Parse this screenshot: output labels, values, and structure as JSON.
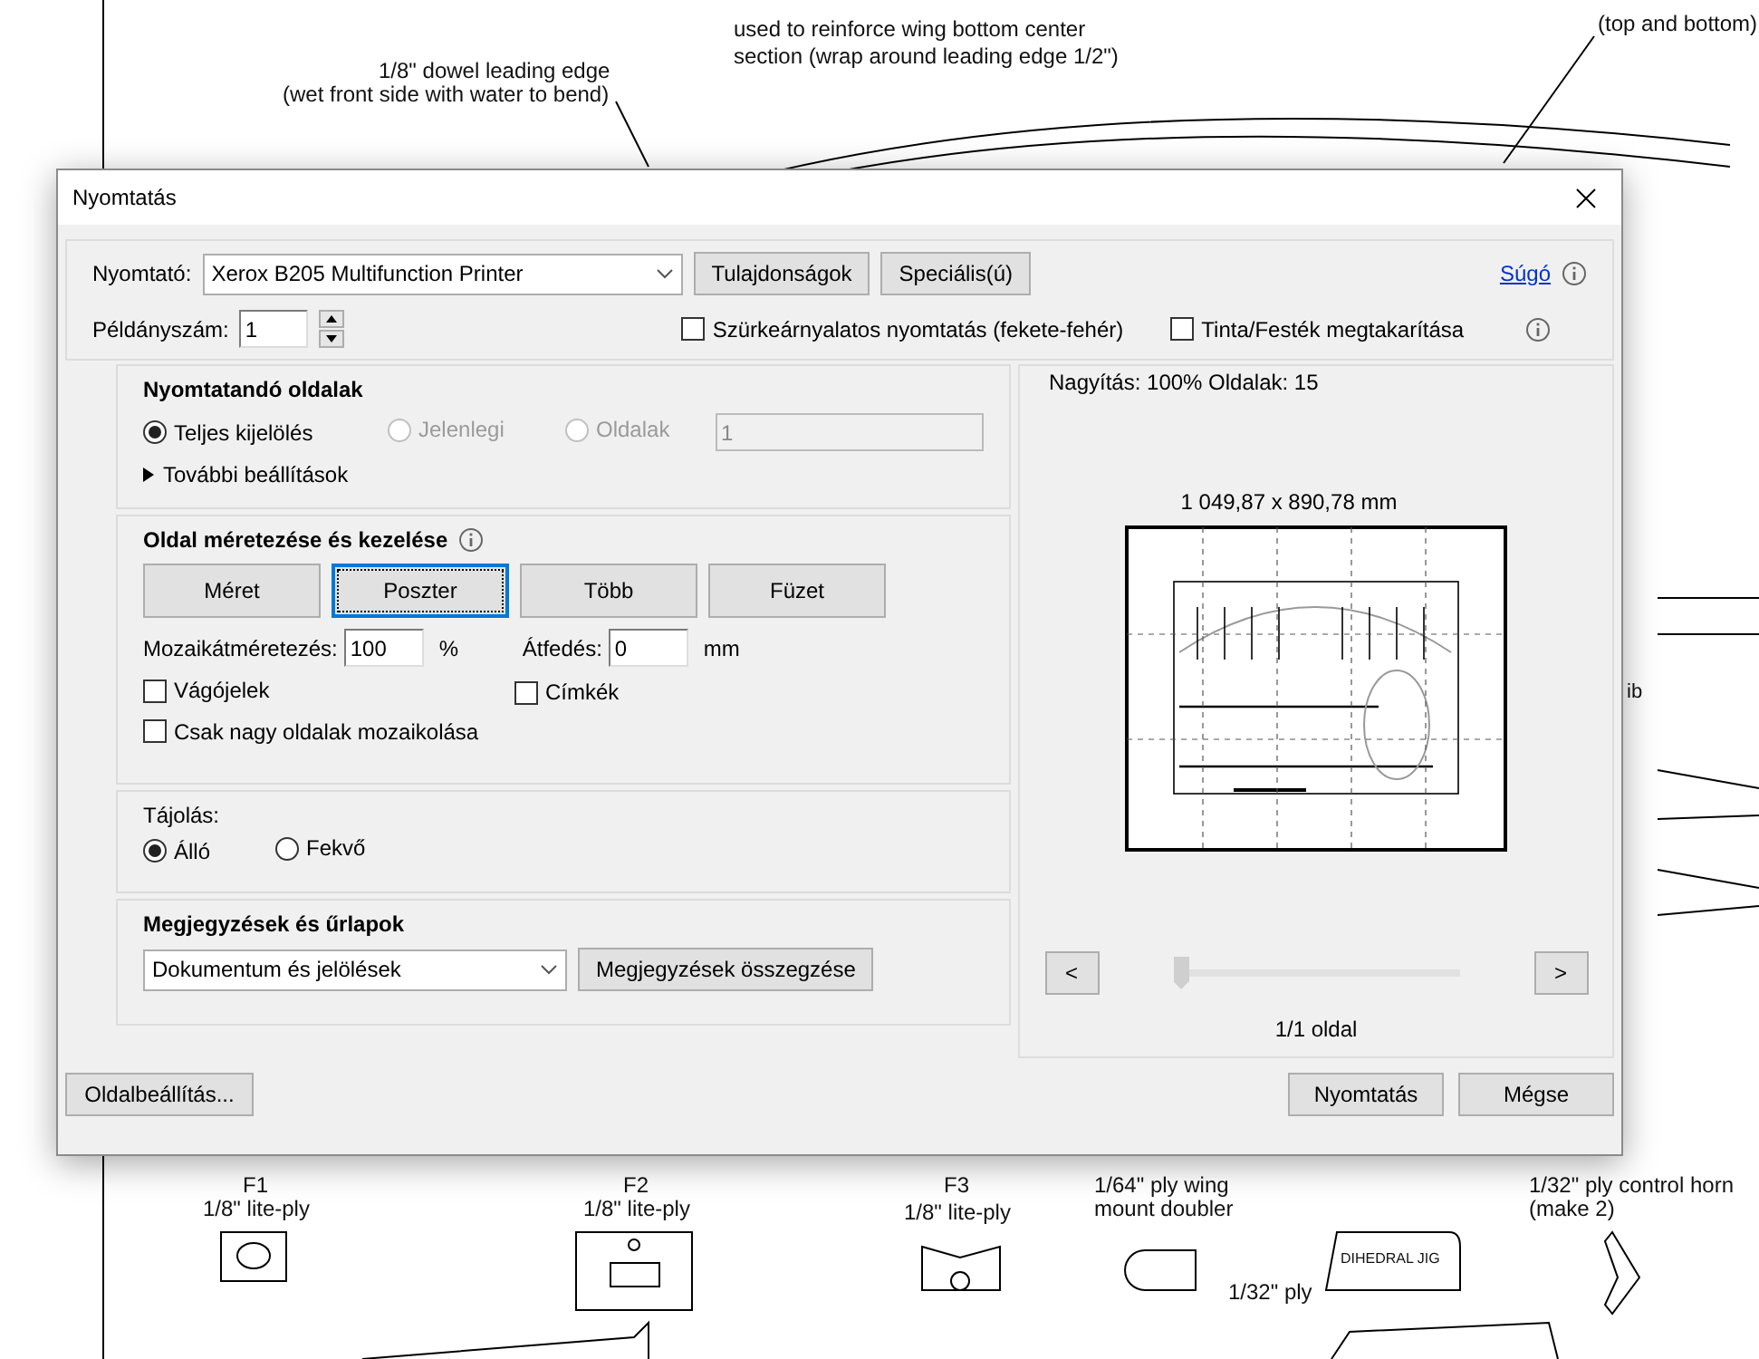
{
  "document": {
    "labels": [
      {
        "text": "used to reinforce wing bottom center"
      },
      {
        "text": "section (wrap around leading edge 1/2\")"
      },
      {
        "text": "1/8\" dowel leading edge"
      },
      {
        "text": "(wet front side with water to bend)"
      },
      {
        "text": "(top and bottom)"
      },
      {
        "text": "ib"
      },
      {
        "text": "F1"
      },
      {
        "text": "1/8\" lite-ply"
      },
      {
        "text": "F2"
      },
      {
        "text": "1/8\" lite-ply"
      },
      {
        "text": "F3"
      },
      {
        "text": "1/8\" lite-ply"
      },
      {
        "text": "1/64\" ply wing"
      },
      {
        "text": "mount doubler"
      },
      {
        "text": "DIHEDRAL JIG"
      },
      {
        "text": "1/32\" ply control horn"
      },
      {
        "text": "(make 2)"
      },
      {
        "text": "1/32\" ply"
      }
    ]
  },
  "dialog": {
    "title": "Nyomtatás",
    "printer": {
      "label": "Nyomtató:",
      "value": "Xerox B205 Multifunction Printer",
      "buttons": [
        "Tulajdonságok",
        "Speciális(ú)"
      ],
      "help": "Súgó"
    },
    "copies": {
      "label": "Példányszám:",
      "value": "1"
    },
    "options": [
      {
        "label": "Szürkeárnyalatos nyomtatás (fekete-fehér)",
        "checked": false
      },
      {
        "label": "Tinta/Festék megtakarítása",
        "checked": false
      }
    ],
    "pages": {
      "title": "Nyomtatandó oldalak",
      "radios": [
        {
          "label": "Teljes kijelölés",
          "selected": true,
          "disabled": false
        },
        {
          "label": "Jelenlegi",
          "selected": false,
          "disabled": true
        },
        {
          "label": "Oldalak",
          "selected": false,
          "disabled": true
        }
      ],
      "range": "1",
      "more": "További beállítások"
    },
    "sizing": {
      "title": "Oldal méretezése és kezelése",
      "modes": [
        {
          "label": "Méret",
          "selected": false
        },
        {
          "label": "Poszter",
          "selected": true
        },
        {
          "label": "Több",
          "selected": false
        },
        {
          "label": "Füzet",
          "selected": false
        }
      ],
      "scale": {
        "label": "Mozaikátméretezés:",
        "value": "100",
        "unit": "%"
      },
      "overlap": {
        "label": "Átfedés:",
        "value": "0",
        "unit": "mm"
      },
      "checks": [
        {
          "label": "Vágójelek",
          "checked": false
        },
        {
          "label": "Címkék",
          "checked": false
        },
        {
          "label": "Csak nagy oldalak mozaikolása",
          "checked": false
        }
      ]
    },
    "orientation": {
      "title": "Tájolás:",
      "radios": [
        {
          "label": "Álló",
          "selected": true
        },
        {
          "label": "Fekvő",
          "selected": false
        }
      ]
    },
    "comments": {
      "title": "Megjegyzések és űrlapok",
      "value": "Dokumentum és jelölések",
      "button": "Megjegyzések összegzése"
    },
    "preview": {
      "zoom": "Nagyítás: 100% Oldalak: 15",
      "size": "1 049,87 x 890,78 mm",
      "prev": "<",
      "next": ">",
      "slider": {
        "level": 0
      },
      "page": "1/1 oldal"
    },
    "footer": {
      "setup": "Oldalbeállítás...",
      "print": "Nyomtatás",
      "cancel": "Mégse"
    }
  }
}
